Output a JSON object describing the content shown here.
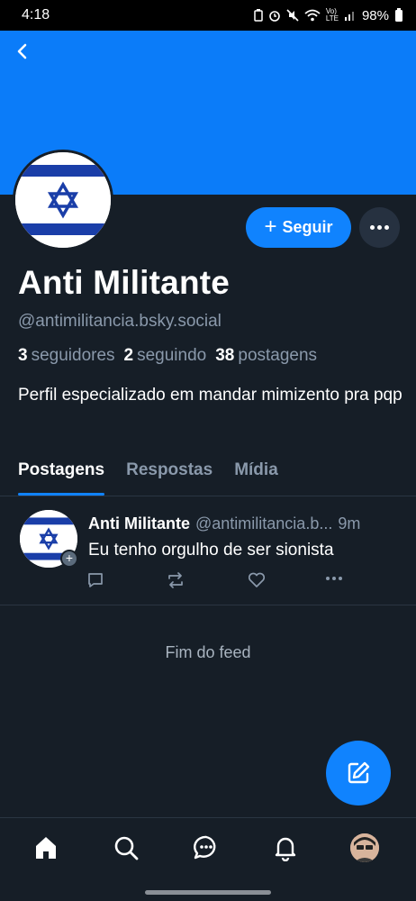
{
  "status_bar": {
    "time": "4:18",
    "battery": "98%"
  },
  "colors": {
    "banner": "#0b7cf9",
    "accent": "#1083fe",
    "background": "#161e27"
  },
  "profile": {
    "display_name": "Anti Militante",
    "handle": "@antimilitancia.bsky.social",
    "followers_count": "3",
    "followers_label": "seguidores",
    "following_count": "2",
    "following_label": "seguindo",
    "posts_count": "38",
    "posts_label": "postagens",
    "bio": "Perfil especializado em mandar mimizento pra pqp",
    "follow_label": "Seguir"
  },
  "tabs": [
    {
      "label": "Postagens",
      "active": true
    },
    {
      "label": "Respostas",
      "active": false
    },
    {
      "label": "Mídia",
      "active": false
    }
  ],
  "post": {
    "author": "Anti Militante",
    "handle": "@antimilitancia.b...",
    "time": "9m",
    "text": "Eu tenho orgulho de ser sionista"
  },
  "feed_end": "Fim do feed",
  "icons": {
    "back": "chevron-left-icon",
    "more": "ellipsis-icon",
    "reply": "comment-icon",
    "repost": "repost-icon",
    "like": "heart-icon",
    "compose": "pencil-square-icon",
    "home": "home-icon",
    "search": "search-icon",
    "chat": "chat-icon",
    "notifications": "bell-icon"
  }
}
